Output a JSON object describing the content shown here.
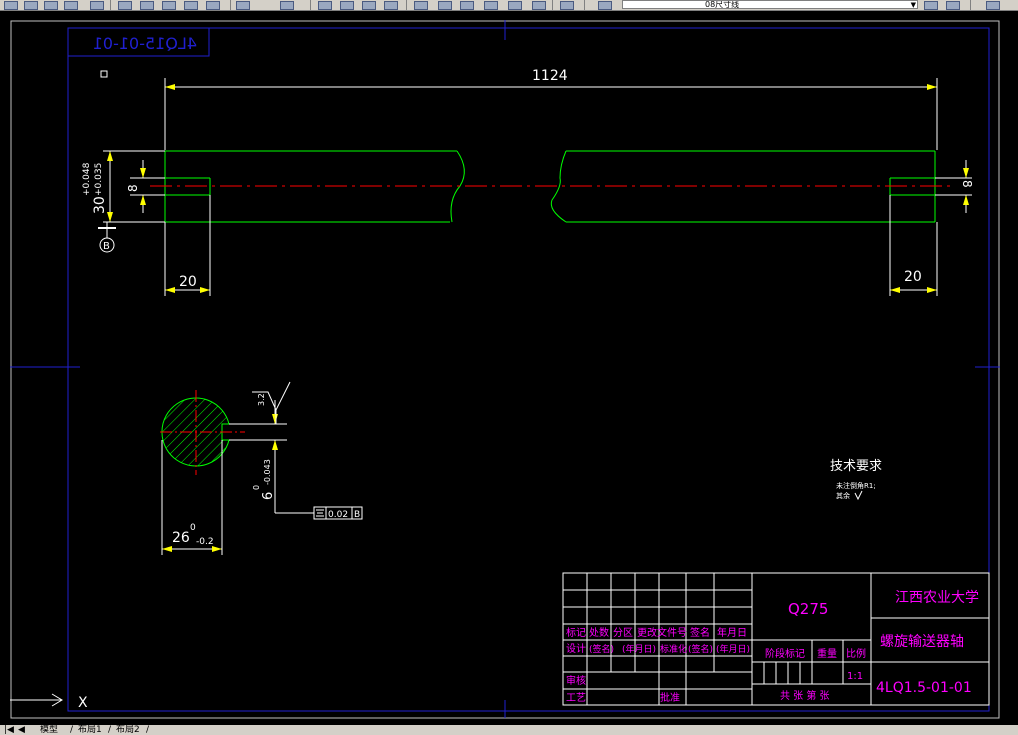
{
  "toolbar": {
    "layer_name": "08尺寸线"
  },
  "drawing": {
    "code_mirrored": "4LQ15-01-01",
    "length_dim": "1124",
    "left_step_len": "20",
    "right_step_len": "20",
    "left_hole_dia": "8",
    "right_hole_dia": "8",
    "shaft_dia": "30",
    "shaft_tol_upper": "+0.048",
    "shaft_tol_lower": "+0.035",
    "datum_letter": "B",
    "section_width": "26",
    "section_width_tol_upper": "0",
    "section_width_tol_lower": "-0.2",
    "key_width": "6",
    "key_tol_upper": "0",
    "key_tol_lower": "-0.043",
    "roughness_value": "3.2",
    "symmetry_tol": "0.02",
    "symmetry_datum": "B",
    "tech_title": "技术要求",
    "tech_line1": "未注倒角R1;",
    "tech_line2": "其余",
    "ucs_label": "X"
  },
  "title_block": {
    "material": "Q275",
    "school": "江西农业大学",
    "part_name": "螺旋输送器轴",
    "part_code": "4LQ1.5-01-01",
    "scale_value": "1:1",
    "row_headers": [
      "标记",
      "处数",
      "分区",
      "更改文件号",
      "签名",
      "年月日"
    ],
    "row_design": [
      "设计",
      "(签名)",
      "(年月日)",
      "标准化",
      "(签名)",
      "(年月日)"
    ],
    "stage_mark": "阶段标记",
    "weight": "重量",
    "scale": "比例",
    "review": "审核",
    "process": "工艺",
    "approve": "批准",
    "sheets": "共 张 第 张"
  },
  "tabs": {
    "model": "模型",
    "layout1": "布局1",
    "layout2": "布局2"
  },
  "colors": {
    "background": "#000000",
    "outline_green": "#00ff00",
    "dimension_white": "#ffffff",
    "arrow_yellow": "#ffff00",
    "centerline_red": "#ff0000",
    "frame_blue": "#2020d0",
    "text_magenta": "#ff00ff"
  }
}
